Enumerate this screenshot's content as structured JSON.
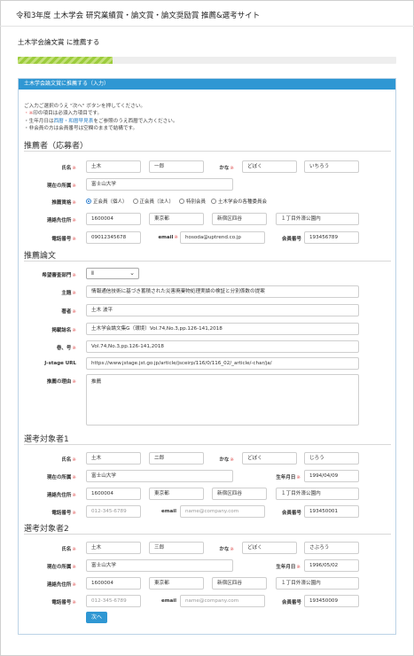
{
  "header": {
    "site_title": "令和3年度 土木学会 研究業績賞・論文賞・論文奨励賞 推薦&選考サイト"
  },
  "page": {
    "title": "土木学会論文賞 に推薦する",
    "progress": 0.25
  },
  "panel": {
    "heading": "土木学会論文賞に推薦する（入力）"
  },
  "notes": {
    "line1": "ご入力ご選択のうえ \"次へ\" ボタンを押してください。",
    "line2_mark": "・※",
    "line2_text": "印の項目は必須入力項目です。",
    "line3_a": "・生年月日は",
    "line3_link": "西暦・和暦早見表",
    "line3_b": "をご参照のうえ西暦で入力ください。",
    "line4": "・非会員の方は会員番号は空欄のままで結構です。"
  },
  "labels": {
    "name": "氏名",
    "kana": "かな",
    "affiliation": "現在の所属",
    "qualification": "推薦資格",
    "contact": "連絡先住所",
    "phone": "電話番号",
    "email": "email",
    "member_no": "会員番号",
    "birthdate": "生年月日",
    "department": "希望審査部門",
    "subject": "主題",
    "author": "著者",
    "journal": "掲載誌名",
    "volume": "巻、号",
    "jstage": "J-stage URL",
    "reason": "推薦の理由",
    "required_mark": "※"
  },
  "recommender": {
    "section_title": "推薦者（応募者）",
    "last_name": "土木",
    "first_name": "一郎",
    "kana_last": "どぼく",
    "kana_first": "いちろう",
    "affiliation": "富士山大学",
    "qualification_options": [
      "正会員（個人）",
      "正会員（法人）",
      "特別会員",
      "土木学会の各種委員会"
    ],
    "zip": "1600004",
    "pref": "東京都",
    "city": "新宿区四谷",
    "address": "１丁目外濠公園内",
    "phone": "09012345678",
    "email": "hosoda@uptrend.co.jp",
    "member_no": "193456789"
  },
  "paper": {
    "section_title": "推薦論文",
    "department": "Ⅱ",
    "subject": "情報通信技術に基づき蓄積された災害廃棄物処理実績の検証と分別係数の提案",
    "author": "土木 波平",
    "journal": "土木学会論文集G（環境）Vol.74,No.3,pp.126-141,2018",
    "volume": "Vol.74,No.3,pp.126-141,2018",
    "jstage": "https://www.jstage.jst.go.jp/article/jsceirp/116/0/116_02/_article/-char/ja/",
    "reason": "推薦"
  },
  "candidate1": {
    "section_title": "選考対象者1",
    "last_name": "土木",
    "first_name": "二郎",
    "kana_last": "どぼく",
    "kana_first": "じろう",
    "affiliation": "富士山大学",
    "birthdate": "1994/04/09",
    "zip": "1600004",
    "pref": "東京都",
    "city": "新宿区四谷",
    "address": "１丁目外濠公園内",
    "phone_placeholder": "012-345-6789",
    "email_placeholder": "name@company.com",
    "member_no": "193450001"
  },
  "candidate2": {
    "section_title": "選考対象者2",
    "last_name": "土木",
    "first_name": "三郎",
    "kana_last": "どぼく",
    "kana_first": "さぶろう",
    "affiliation": "富士山大学",
    "birthdate": "1996/05/02",
    "zip": "1600004",
    "pref": "東京都",
    "city": "新宿区四谷",
    "address": "１丁目外濠公園内",
    "phone_placeholder": "012-345-6789",
    "email_placeholder": "name@company.com",
    "member_no": "193450009"
  },
  "buttons": {
    "next": "次へ"
  },
  "colors": {
    "accent": "#2f97d3",
    "progress": "#9ccc3c",
    "required": "#e05a5a"
  }
}
